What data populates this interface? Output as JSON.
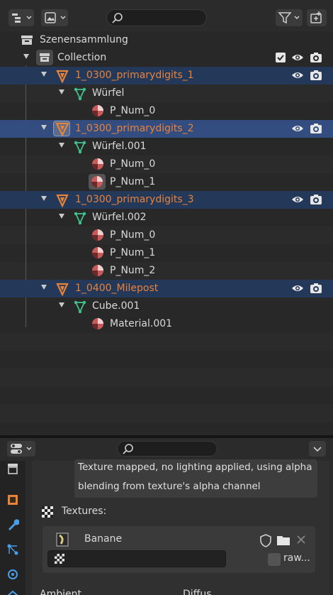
{
  "outliner": {
    "root_label": "Szenensammlung",
    "collection_label": "Collection",
    "rows": [
      {
        "label": "1_0300_primarydigits_1",
        "type": "object"
      },
      {
        "label": "Würfel",
        "type": "mesh"
      },
      {
        "label": "P_Num_0",
        "type": "material"
      },
      {
        "label": "1_0300_primarydigits_2",
        "type": "object"
      },
      {
        "label": "Würfel.001",
        "type": "mesh"
      },
      {
        "label": "P_Num_0",
        "type": "material"
      },
      {
        "label": "P_Num_1",
        "type": "material"
      },
      {
        "label": "1_0300_primarydigits_3",
        "type": "object"
      },
      {
        "label": "Würfel.002",
        "type": "mesh"
      },
      {
        "label": "P_Num_0",
        "type": "material"
      },
      {
        "label": "P_Num_1",
        "type": "material"
      },
      {
        "label": "P_Num_2",
        "type": "material"
      },
      {
        "label": "1_0400_Milepost",
        "type": "object"
      },
      {
        "label": "Cube.001",
        "type": "mesh"
      },
      {
        "label": "Material.001",
        "type": "material"
      }
    ]
  },
  "properties": {
    "description_line1": "Texture mapped, no lighting applied, using alpha",
    "description_line2": "blending from texture's alpha channel",
    "textures_label": "Textures:",
    "texture_name": "Banane",
    "raw_label": "raw...",
    "bottom_label_left": "Ambient",
    "bottom_label_right": "Diffus"
  },
  "colors": {
    "selected_row": "#334d80",
    "highlight_row": "#24385a",
    "object_orange": "#e8833a",
    "mesh_green": "#3fc38c",
    "material_red": "#c85a5a"
  }
}
